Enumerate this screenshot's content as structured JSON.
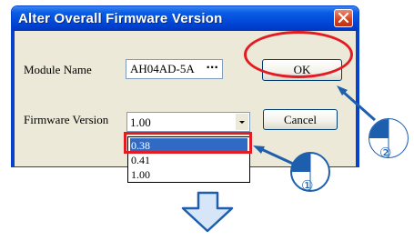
{
  "dialog": {
    "title": "Alter Overall Firmware Version",
    "module_label": "Module Name",
    "module_value": "AH04AD-5A",
    "browse_label": "···",
    "firmware_label": "Firmware Version",
    "firmware_value": "1.00",
    "ok_label": "OK",
    "cancel_label": "Cancel"
  },
  "dropdown": {
    "options": [
      "0.38",
      "0.41",
      "1.00"
    ],
    "highlighted_option": "0.38"
  },
  "annotations": {
    "step1": "①",
    "step2": "②"
  },
  "colors": {
    "title_bar": "#0a5ee5",
    "highlight_red": "#e31b23",
    "callout_blue": "#1d5fad",
    "selection": "#316ac5",
    "down_arrow_fill": "#d6e6f8"
  }
}
